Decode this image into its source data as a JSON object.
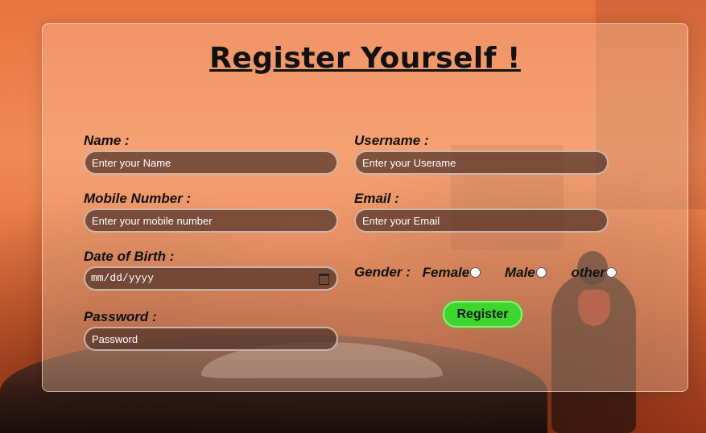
{
  "form": {
    "title": "Register Yourself !",
    "name": {
      "label": "Name :",
      "placeholder": "Enter your Name"
    },
    "username": {
      "label": "Username :",
      "placeholder": "Enter your Userame"
    },
    "mobile": {
      "label": "Mobile Number :",
      "placeholder": "Enter your mobile number"
    },
    "email": {
      "label": "Email :",
      "placeholder": "Enter your Email"
    },
    "dob": {
      "label": "Date of Birth :",
      "placeholder": "mm/dd/yyyy",
      "icon": "calendar-icon"
    },
    "password": {
      "label": "Password :",
      "placeholder": "Password"
    },
    "gender": {
      "label": "Gender :",
      "options": [
        "Female",
        "Male",
        "other"
      ]
    },
    "register_label": "Register"
  },
  "colors": {
    "button": "#3dd62c",
    "input_bg": "#50322880",
    "background": "#e8733f"
  }
}
